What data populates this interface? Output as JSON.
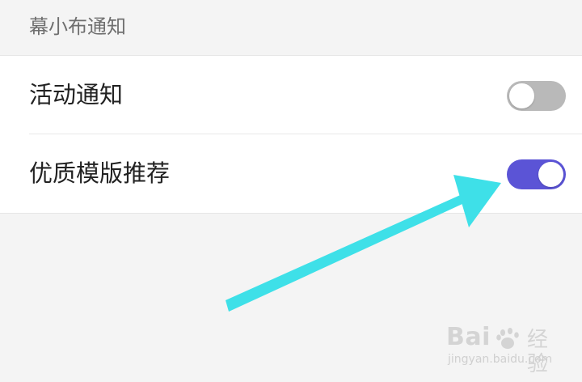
{
  "section": {
    "title": "幕小布通知"
  },
  "settings": {
    "items": [
      {
        "label": "活动通知",
        "enabled": false
      },
      {
        "label": "优质模版推荐",
        "enabled": true
      }
    ]
  },
  "colors": {
    "toggle_on": "#5b54d6",
    "toggle_off": "#b9b9b9",
    "annotation_arrow": "#3ee0e8"
  },
  "watermark": {
    "brand_left": "Bai",
    "brand_right": "经验",
    "url": "jingyan.baidu.com"
  }
}
